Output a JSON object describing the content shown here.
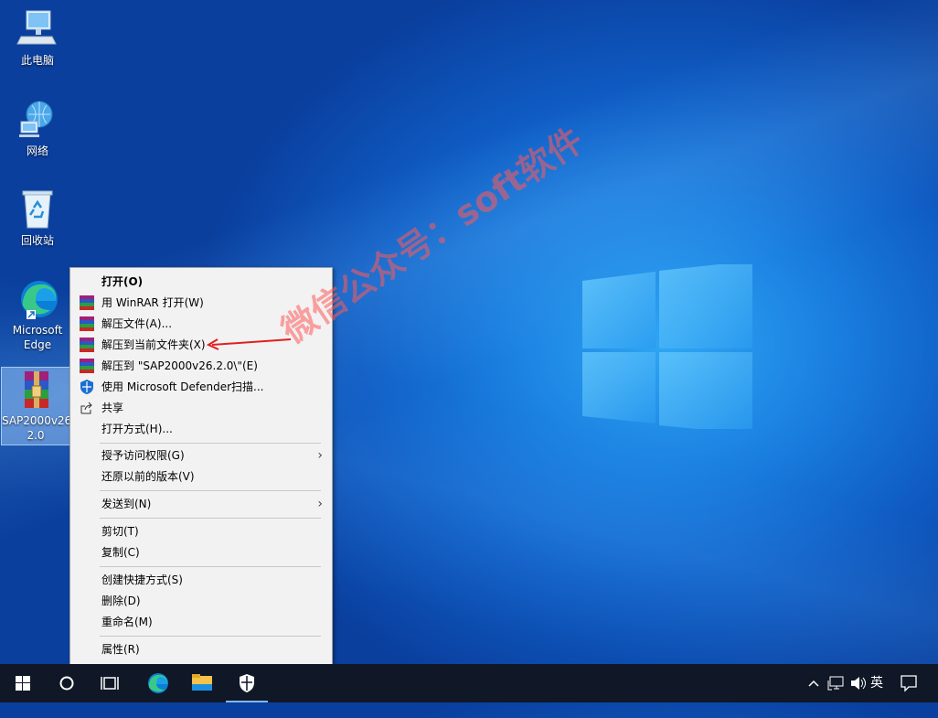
{
  "desktop": {
    "icons": [
      {
        "label": "此电脑",
        "icon": "computer-icon"
      },
      {
        "label": "网络",
        "icon": "network-icon"
      },
      {
        "label": "回收站",
        "icon": "recycle-bin-icon"
      },
      {
        "label_line1": "Microsoft",
        "label_line2": "Edge",
        "icon": "edge-icon"
      },
      {
        "label_line1": "SAP2000v26.",
        "label_line2": "2.0",
        "icon": "winrar-archive-icon"
      }
    ]
  },
  "context_menu": {
    "items": [
      {
        "label": "打开(O)",
        "bold": true
      },
      {
        "label": "用 WinRAR 打开(W)",
        "icon": "winrar-icon"
      },
      {
        "label": "解压文件(A)...",
        "icon": "winrar-icon"
      },
      {
        "label": "解压到当前文件夹(X)",
        "icon": "winrar-icon"
      },
      {
        "label": "解压到 \"SAP2000v26.2.0\\\"(E)",
        "icon": "winrar-icon"
      },
      {
        "label": "使用 Microsoft Defender扫描...",
        "icon": "defender-shield-icon"
      },
      {
        "label": "共享",
        "icon": "share-icon"
      },
      {
        "label": "打开方式(H)..."
      },
      {
        "label": "授予访问权限(G)",
        "submenu": true
      },
      {
        "label": "还原以前的版本(V)"
      },
      {
        "label": "发送到(N)",
        "submenu": true
      },
      {
        "label": "剪切(T)"
      },
      {
        "label": "复制(C)"
      },
      {
        "label": "创建快捷方式(S)"
      },
      {
        "label": "删除(D)"
      },
      {
        "label": "重命名(M)"
      },
      {
        "label": "属性(R)"
      }
    ]
  },
  "watermark": "微信公众号：soft软件",
  "taskbar": {
    "apps": [
      "start-icon",
      "search-icon",
      "task-view-icon",
      "edge-icon",
      "file-explorer-icon",
      "security-shield-icon"
    ],
    "tray": {
      "ime": "英"
    }
  },
  "colors": {
    "annotation_arrow": "#e02020",
    "taskbar": "#101727"
  }
}
